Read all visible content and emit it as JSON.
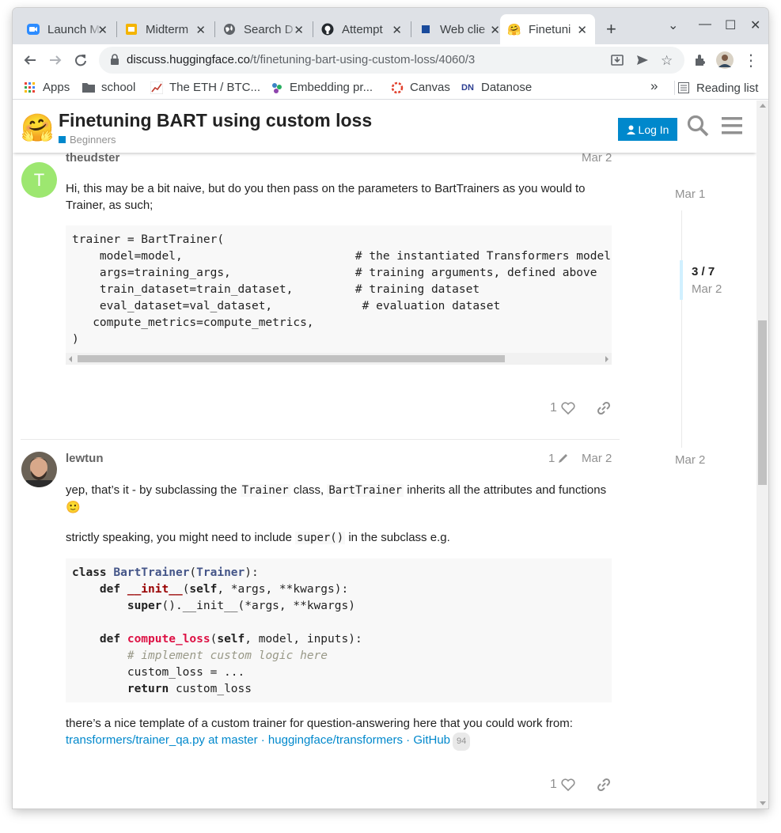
{
  "tabs": [
    {
      "title": "Launch M",
      "icon": "zoom-icon",
      "color": "#2d8cff"
    },
    {
      "title": "Midterm",
      "icon": "slides-icon",
      "color": "#f4b400"
    },
    {
      "title": "Search D",
      "icon": "globe-icon",
      "color": "#5f6368"
    },
    {
      "title": "Attempt",
      "icon": "github-icon",
      "color": "#24292e"
    },
    {
      "title": "Web clie",
      "icon": "doc-icon",
      "color": "#1a4b9c"
    },
    {
      "title": "Finetuni",
      "icon": "hugging-face-icon",
      "color": "#ffcc4d"
    }
  ],
  "toolbar": {
    "url_domain": "discuss.huggingface.co",
    "url_path": "/t/finetuning-bart-using-custom-loss/4060/3"
  },
  "bookmarks": {
    "apps": "Apps",
    "school": "school",
    "eth": "The ETH / BTC...",
    "embedding": "Embedding pr...",
    "canvas": "Canvas",
    "datanose_icon": "DN",
    "datanose": "Datanose",
    "more": "»",
    "reading_list": "Reading list"
  },
  "header": {
    "logo": "🤗",
    "title": "Finetuning BART using custom loss",
    "category": "Beginners",
    "login": "Log In",
    "category_color": "#0088cc"
  },
  "post1": {
    "avatar_letter": "T",
    "avatar_color": "#9de770",
    "username": "theudster",
    "date": "Mar 2",
    "text": "Hi, this may be a bit naive, but do you then pass on the parameters to BartTrainers as you would to Trainer, as such;",
    "code": [
      "trainer = BartTrainer(",
      "    model=model,                         # the instantiated Transformers model",
      "    args=training_args,                  # training arguments, defined above",
      "    train_dataset=train_dataset,         # training dataset",
      "    eval_dataset=val_dataset,             # evaluation dataset",
      "   compute_metrics=compute_metrics,",
      ")"
    ],
    "likes": "1"
  },
  "post2": {
    "username": "lewtun",
    "edits": "1",
    "date": "Mar 2",
    "text1_a": "yep, that’s it - by subclassing the ",
    "text1_code1": "Trainer",
    "text1_b": " class, ",
    "text1_code2": "BartTrainer",
    "text1_c": " inherits all the attributes and functions",
    "emoji": "🙂",
    "text2_a": "strictly speaking, you might need to include ",
    "text2_code": "super()",
    "text2_b": " in the subclass e.g.",
    "code": {
      "l1_kw": "class ",
      "l1_cls": "BartTrainer",
      "l1_p": "(",
      "l1_base": "Trainer",
      "l1_end": "):",
      "l2_kw": "def ",
      "l2_fn": "__init__",
      "l2_p": "(",
      "l2_self": "self",
      "l2_end": ", *args, **kwargs):",
      "l3_kw": "super",
      "l3_end": "().__init__(*args, **kwargs)",
      "l4_kw": "def ",
      "l4_fn": "compute_loss",
      "l4_p": "(",
      "l4_self": "self",
      "l4_end": ", model, inputs):",
      "l5": "# implement custom logic here",
      "l6": "custom_loss = ...",
      "l7_kw": "return",
      "l7_end": " custom_loss"
    },
    "text3": "there’s a nice template of a custom trainer for question-answering here that you could work from:",
    "link": "transformers/trainer_qa.py at master · huggingface/transformers · GitHub",
    "link_count": "94",
    "likes": "1"
  },
  "timeline": {
    "start": "Mar 1",
    "position": "3 / 7",
    "position_date": "Mar 2",
    "end": "Mar 2"
  }
}
